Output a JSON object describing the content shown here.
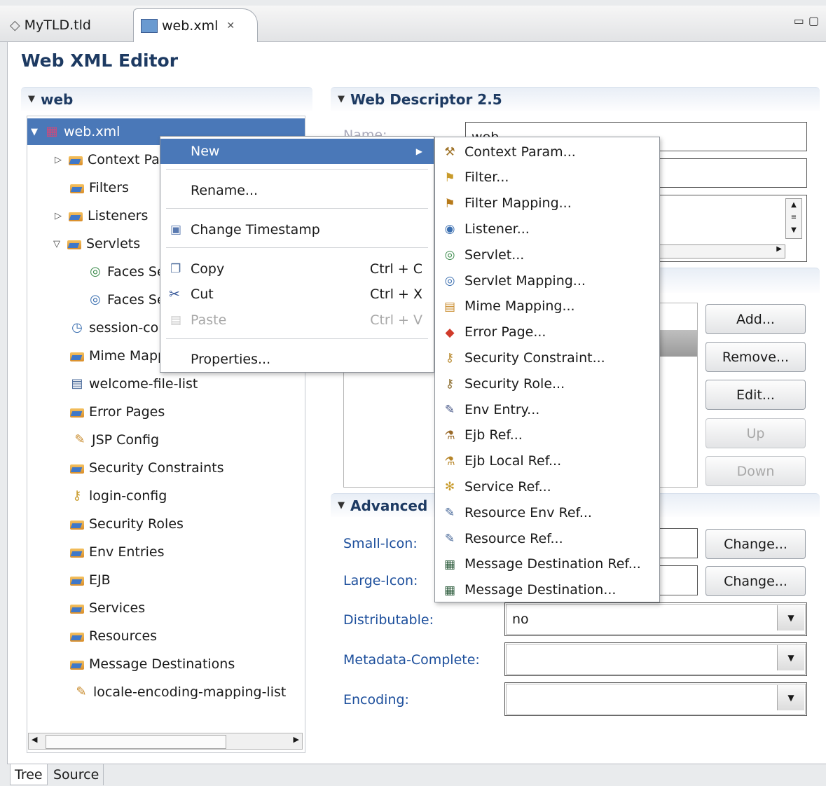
{
  "tabs": [
    {
      "label": "MyTLD.tld",
      "icon": "tld-file-icon"
    },
    {
      "label": "web.xml",
      "icon": "web-xml-icon",
      "close": "✕"
    }
  ],
  "editor_title": "Web XML Editor",
  "tree_section": {
    "title": "web"
  },
  "tree": [
    {
      "label": "web.xml",
      "arrow": "▼",
      "icon": "web-xml-icon",
      "selected": true
    },
    {
      "label": "Context Param",
      "arrow": "▷",
      "icon": "folder-icon"
    },
    {
      "label": "Filters",
      "arrow": "",
      "icon": "folder-icon"
    },
    {
      "label": "Listeners",
      "arrow": "▷",
      "icon": "folder-icon"
    },
    {
      "label": "Servlets",
      "arrow": "▽",
      "icon": "folder-icon"
    },
    {
      "label": "Faces Servlet",
      "arrow": "",
      "icon": "servlet-icon"
    },
    {
      "label": "Faces Servlet",
      "arrow": "",
      "icon": "servlet-mapping-icon"
    },
    {
      "label": "session-config",
      "arrow": "",
      "icon": "session-icon"
    },
    {
      "label": "Mime Mappings",
      "arrow": "",
      "icon": "folder-icon"
    },
    {
      "label": "welcome-file-list",
      "arrow": "",
      "icon": "welcome-icon"
    },
    {
      "label": "Error Pages",
      "arrow": "",
      "icon": "folder-icon"
    },
    {
      "label": "JSP Config",
      "arrow": "",
      "icon": "pen-icon"
    },
    {
      "label": "Security Constraints",
      "arrow": "",
      "icon": "folder-icon"
    },
    {
      "label": "login-config",
      "arrow": "",
      "icon": "key-icon"
    },
    {
      "label": "Security Roles",
      "arrow": "",
      "icon": "folder-icon"
    },
    {
      "label": "Env Entries",
      "arrow": "",
      "icon": "folder-icon"
    },
    {
      "label": "EJB",
      "arrow": "",
      "icon": "folder-icon"
    },
    {
      "label": "Services",
      "arrow": "",
      "icon": "folder-icon"
    },
    {
      "label": "Resources",
      "arrow": "",
      "icon": "folder-icon"
    },
    {
      "label": "Message Destinations",
      "arrow": "",
      "icon": "folder-icon"
    },
    {
      "label": "locale-encoding-mapping-list",
      "arrow": "",
      "icon": "pen-icon"
    }
  ],
  "descriptor_section": {
    "title": "Web Descriptor 2.5",
    "name_label": "Name:",
    "name_value": "web"
  },
  "list_buttons": {
    "add": "Add...",
    "remove": "Remove...",
    "edit": "Edit...",
    "up": "Up",
    "down": "Down"
  },
  "advanced_section": {
    "title": "Advanced"
  },
  "form": {
    "small_icon_label": "Small-Icon:",
    "large_icon_label": "Large-Icon:",
    "change": "Change...",
    "distributable_label": "Distributable:",
    "distributable_value": "no",
    "metadata_label": "Metadata-Complete:",
    "metadata_value": "",
    "encoding_label": "Encoding:",
    "encoding_value": ""
  },
  "context_menu": {
    "new": "New",
    "rename": "Rename...",
    "change_timestamp": "Change Timestamp",
    "copy": "Copy",
    "copy_sc": "Ctrl + C",
    "cut": "Cut",
    "cut_sc": "Ctrl + X",
    "paste": "Paste",
    "paste_sc": "Ctrl + V",
    "properties": "Properties..."
  },
  "submenu": [
    {
      "label": "Context Param...",
      "glyph": "⚒",
      "color": "#a0742a"
    },
    {
      "label": "Filter...",
      "glyph": "⚑",
      "color": "#c89a2a"
    },
    {
      "label": "Filter Mapping...",
      "glyph": "⚑",
      "color": "#b77a1a"
    },
    {
      "label": "Listener...",
      "glyph": "◉",
      "color": "#3b6fb0"
    },
    {
      "label": "Servlet...",
      "glyph": "◎",
      "color": "#3a8a4a"
    },
    {
      "label": "Servlet Mapping...",
      "glyph": "◎",
      "color": "#3b6fb0"
    },
    {
      "label": "Mime Mapping...",
      "glyph": "▤",
      "color": "#c88a2a"
    },
    {
      "label": "Error Page...",
      "glyph": "◆",
      "color": "#d03a2a"
    },
    {
      "label": "Security Constraint...",
      "glyph": "⚷",
      "color": "#b7862a"
    },
    {
      "label": "Security Role...",
      "glyph": "⚷",
      "color": "#8a6a2a"
    },
    {
      "label": "Env Entry...",
      "glyph": "✎",
      "color": "#4a5a8a"
    },
    {
      "label": "Ejb Ref...",
      "glyph": "⚗",
      "color": "#9a6a2a"
    },
    {
      "label": "Ejb Local Ref...",
      "glyph": "⚗",
      "color": "#b7862a"
    },
    {
      "label": "Service Ref...",
      "glyph": "✻",
      "color": "#c89a2a"
    },
    {
      "label": "Resource Env Ref...",
      "glyph": "✎",
      "color": "#4a6a9a"
    },
    {
      "label": "Resource Ref...",
      "glyph": "✎",
      "color": "#4a6a9a"
    },
    {
      "label": "Message Destination Ref...",
      "glyph": "▦",
      "color": "#2a5a3a"
    },
    {
      "label": "Message Destination...",
      "glyph": "▦",
      "color": "#2a5a3a"
    }
  ],
  "bottom_tabs": {
    "tree": "Tree",
    "source": "Source"
  }
}
